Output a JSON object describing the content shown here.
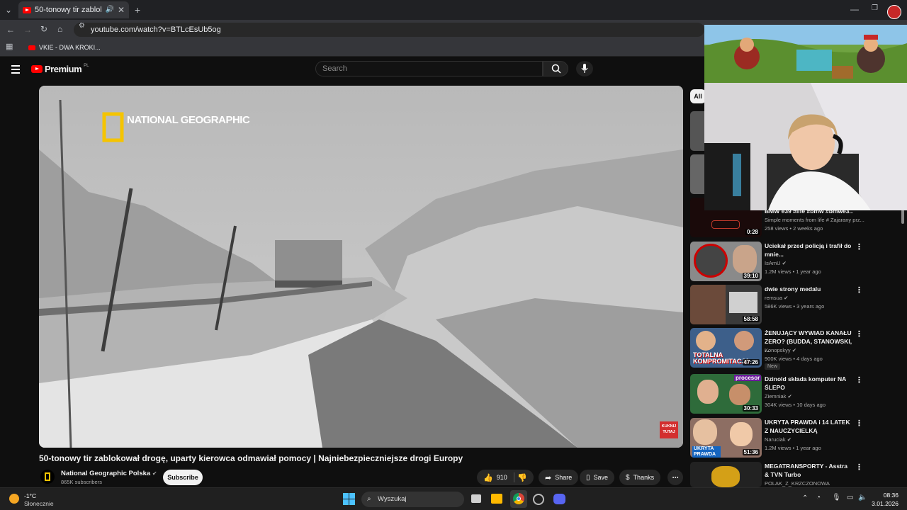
{
  "browser": {
    "tab_title": "50-tonowy tir zablokował d",
    "url": "youtube.com/watch?v=BTLcEsUb5og",
    "bookmark": "VKIE - DWA KROKI..."
  },
  "youtube": {
    "logo": "Premium",
    "logo_sup": "PL",
    "search_placeholder": "Search",
    "chip_all": "All"
  },
  "video": {
    "watermark": "NATIONAL GEOGRAPHIC",
    "corner_badge": "KUKNIJ TUTAJ",
    "title": "50-tonowy tir zablokował drogę, uparty kierowca odmawiał pomocy | Najniebezpieczniejsze drogi Europy",
    "channel": "National Geographic Polska",
    "subscribers": "865K subscribers",
    "subscribe": "Subscribe",
    "likes": "910",
    "share": "Share",
    "save": "Save",
    "thanks": "Thanks"
  },
  "sidebar": [
    {
      "title": "BMW e39 #life #bmw #bmwe3...",
      "channel": "Simple moments from life # Zajarany prz...",
      "meta": "258 views • 2 weeks ago",
      "duration": "0:28"
    },
    {
      "title": "Uciekał przed policją i trafił do mnie...",
      "channel": "IsAmU",
      "meta": "1.2M views • 1 year ago",
      "duration": "39:10"
    },
    {
      "title": "dwie strony medalu",
      "channel": "remsua",
      "meta": "586K views • 3 years ago",
      "duration": "58:58"
    },
    {
      "title": "ŻENUJĄCY WYWIAD KANAŁU ZERO? (BUDDA, STANOWSKI, ...",
      "channel": "Konopskyy",
      "meta": "900K views • 4 days ago",
      "duration": "47:26",
      "badge": "New"
    },
    {
      "title": "Dzinold składa komputer NA ŚLEPO",
      "channel": "Ziemniak",
      "meta": "304K views • 10 days ago",
      "duration": "30:33"
    },
    {
      "title": "UKRYTA PRAWDA i 14 LATEK Z NAUCZYCIELKĄ",
      "channel": "Naruciak",
      "meta": "1.2M views • 1 year ago",
      "duration": "51:36"
    },
    {
      "title": "MEGATRANSPORTY - Asstra & TVN Turbo",
      "channel": "POLAK_Z_KRZCZONOWA",
      "meta": "",
      "duration": ""
    }
  ],
  "thumb_texts": {
    "totalna": "TOTALNA KOMPROMITACJA",
    "procesor": "procesor",
    "ukryta": "UKRYTA PRAWDA"
  },
  "taskbar": {
    "temp": "-1°C",
    "weather": "Słonecznie",
    "search": "Wyszukaj",
    "time": "08:36",
    "date": "3.01.2026"
  },
  "colors": {
    "youtube_red": "#ff0000",
    "ng_yellow": "#f5c400"
  }
}
